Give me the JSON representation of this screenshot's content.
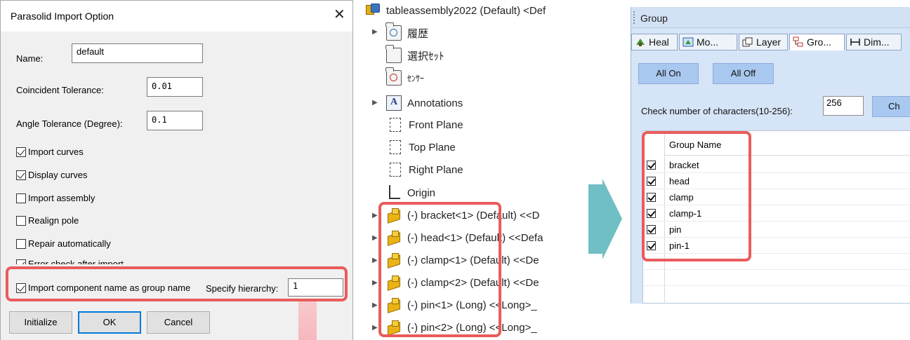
{
  "dialog": {
    "title": "Parasolid Import Option",
    "close_glyph": "✕",
    "name_label": "Name:",
    "name_value": "default",
    "coincident_label": "Coincident Tolerance:",
    "coincident_value": "0.01",
    "angle_label": "Angle Tolerance (Degree):",
    "angle_value": "0.1",
    "options": [
      {
        "label": "Import curves",
        "checked": true
      },
      {
        "label": "Display curves",
        "checked": true
      },
      {
        "label": "Import assembly",
        "checked": false
      },
      {
        "label": "Realign pole",
        "checked": false
      },
      {
        "label": "Repair automatically",
        "checked": false
      },
      {
        "label": "Error check after import",
        "checked": true
      },
      {
        "label": "Import component name as group name",
        "checked": true
      }
    ],
    "hierarchy_label": "Specify hierarchy:",
    "hierarchy_value": "1",
    "buttons": {
      "initialize": "Initialize",
      "ok": "OK",
      "cancel": "Cancel"
    }
  },
  "tree": {
    "root": "tableassembly2022 (Default) <Def",
    "nodes": [
      {
        "label": "履歴",
        "icon": "history-folder-icon"
      },
      {
        "label": "選択ｾｯﾄ",
        "icon": "selection-set-icon"
      },
      {
        "label": "ｾﾝｻｰ",
        "icon": "sensor-icon"
      },
      {
        "label": "Annotations",
        "icon": "annotations-icon"
      },
      {
        "label": "Front Plane",
        "icon": "plane-icon"
      },
      {
        "label": "Top Plane",
        "icon": "plane-icon"
      },
      {
        "label": "Right Plane",
        "icon": "plane-icon"
      },
      {
        "label": "Origin",
        "icon": "origin-icon"
      }
    ],
    "components": [
      "(-) bracket<1> (Default) <<D",
      "(-) head<1> (Default) <<Defa",
      "(-) clamp<1> (Default) <<De",
      "(-) clamp<2> (Default) <<De",
      "(-) pin<1> (Long) <<Long>_",
      "(-) pin<2> (Long) <<Long>_"
    ]
  },
  "group_panel": {
    "title": "Group",
    "tabs": [
      "Heal",
      "Mo...",
      "Layer",
      "Gro...",
      "Dim..."
    ],
    "all_on": "All On",
    "all_off": "All Off",
    "check_label": "Check number of characters(10-256):",
    "check_value": "256",
    "check_button": "Ch",
    "column_header": "Group Name",
    "groups": [
      "bracket",
      "head",
      "clamp",
      "clamp-1",
      "pin",
      "pin-1"
    ]
  },
  "colors": {
    "highlight": "#ea5b5b",
    "arrow": "#6fbfc4",
    "panel_blue": "#d6e4f7",
    "button_blue": "#a9c8f0"
  }
}
